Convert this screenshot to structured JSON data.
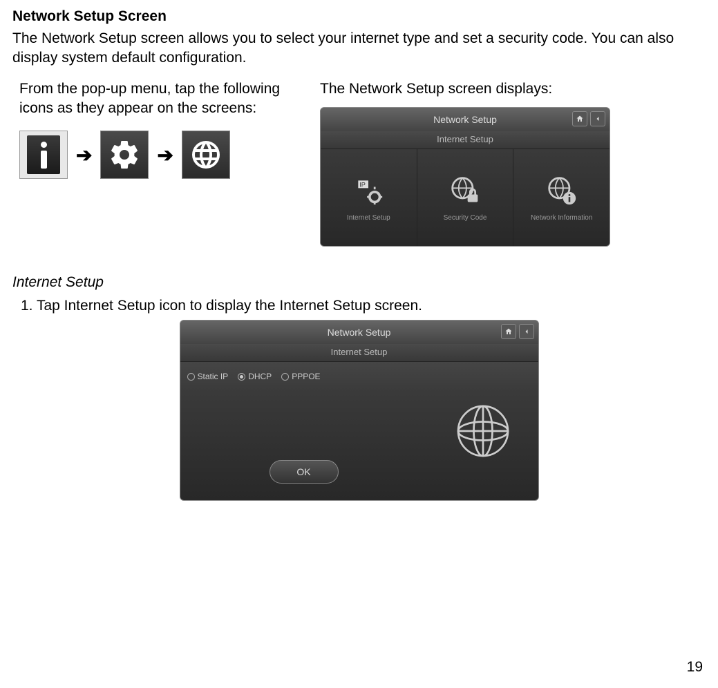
{
  "section": {
    "title": "Network Setup Screen",
    "intro": "The Network Setup screen allows you to select your internet type and set a security code. You can also display system default configuration.",
    "popup_instruction": "From the pop-up menu, tap the following icons as they appear on the screens:",
    "displays_label": "The Network Setup screen displays:"
  },
  "icon_sequence": {
    "arrow": "➔"
  },
  "network_setup_screen": {
    "title": "Network Setup",
    "subtitle": "Internet Setup",
    "tiles": [
      {
        "label": "Internet Setup"
      },
      {
        "label": "Security Code"
      },
      {
        "label": "Network Information"
      }
    ]
  },
  "internet_setup": {
    "heading": "Internet Setup",
    "step1": "1.  Tap Internet Setup icon to display the Internet Setup screen.",
    "screen": {
      "title": "Network Setup",
      "subtitle": "Internet Setup",
      "options": [
        {
          "label": "Static IP",
          "selected": false
        },
        {
          "label": "DHCP",
          "selected": true
        },
        {
          "label": "PPPOE",
          "selected": false
        }
      ],
      "ok": "OK"
    }
  },
  "page_number": "19"
}
